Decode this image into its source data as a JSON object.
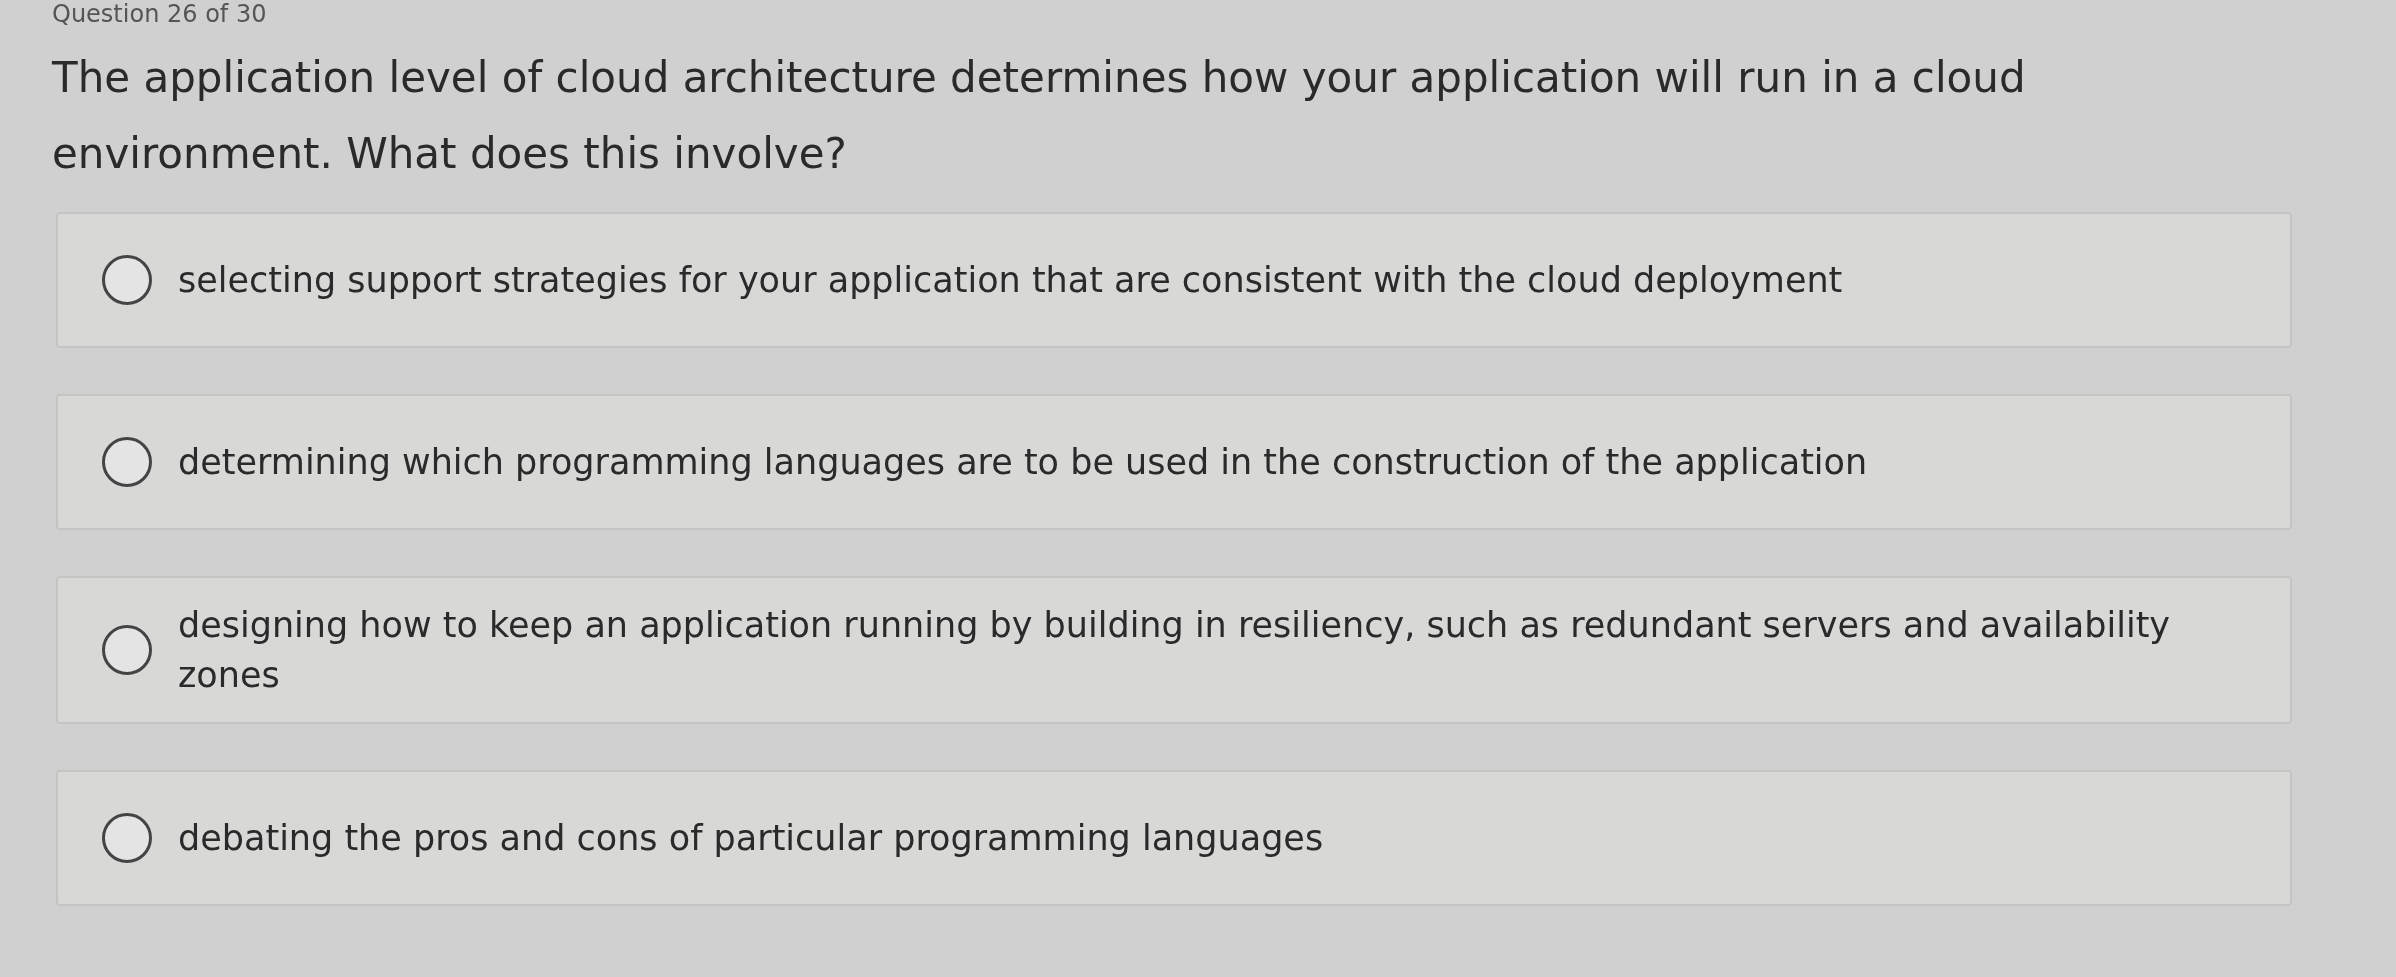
{
  "header": "Question 26 of 30",
  "question": "The application level of cloud architecture determines how your application will run in a cloud environment. What does this involve?",
  "options": [
    {
      "label": "selecting support strategies for your application that are consistent with the cloud deployment",
      "selected": false
    },
    {
      "label": "determining which programming languages are to be used in the construction of the application",
      "selected": false
    },
    {
      "label": "designing how to keep an application running by building in resiliency, such as redundant servers and availability zones",
      "selected": false
    },
    {
      "label": "debating the pros and cons of particular programming languages",
      "selected": false
    }
  ]
}
